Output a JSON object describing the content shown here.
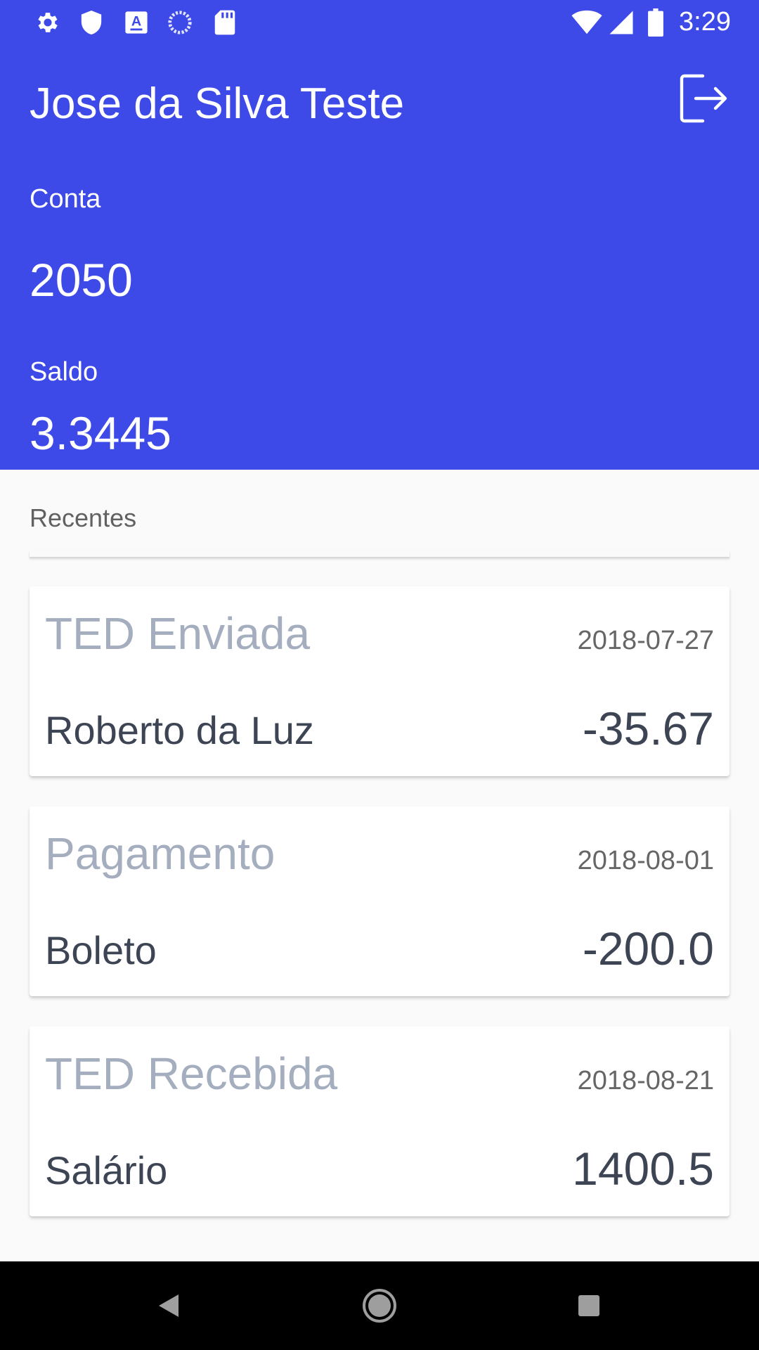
{
  "status_bar": {
    "time": "3:29",
    "left_icons": [
      "settings-icon",
      "shield-icon",
      "font-icon",
      "loading-icon",
      "sd-card-icon"
    ],
    "right_icons": [
      "wifi-icon",
      "signal-icon",
      "battery-icon"
    ]
  },
  "header": {
    "user_name": "Jose da Silva Teste",
    "account_label": "Conta",
    "account_number": "2050",
    "balance_label": "Saldo",
    "balance_value": "3.3445",
    "logout_icon": "logout-icon",
    "background_color": "#3d4ae8"
  },
  "recent": {
    "title": "Recentes",
    "transactions": [
      {
        "type": "TED Enviada",
        "date": "2018-07-27",
        "name": "Roberto da Luz",
        "amount": "-35.67"
      },
      {
        "type": "Pagamento",
        "date": "2018-08-01",
        "name": "Boleto",
        "amount": "-200.0"
      },
      {
        "type": "TED Recebida",
        "date": "2018-08-21",
        "name": "Salário",
        "amount": "1400.5"
      }
    ]
  },
  "nav_bar": {
    "icons": [
      "back-icon",
      "home-icon",
      "recents-icon"
    ]
  }
}
